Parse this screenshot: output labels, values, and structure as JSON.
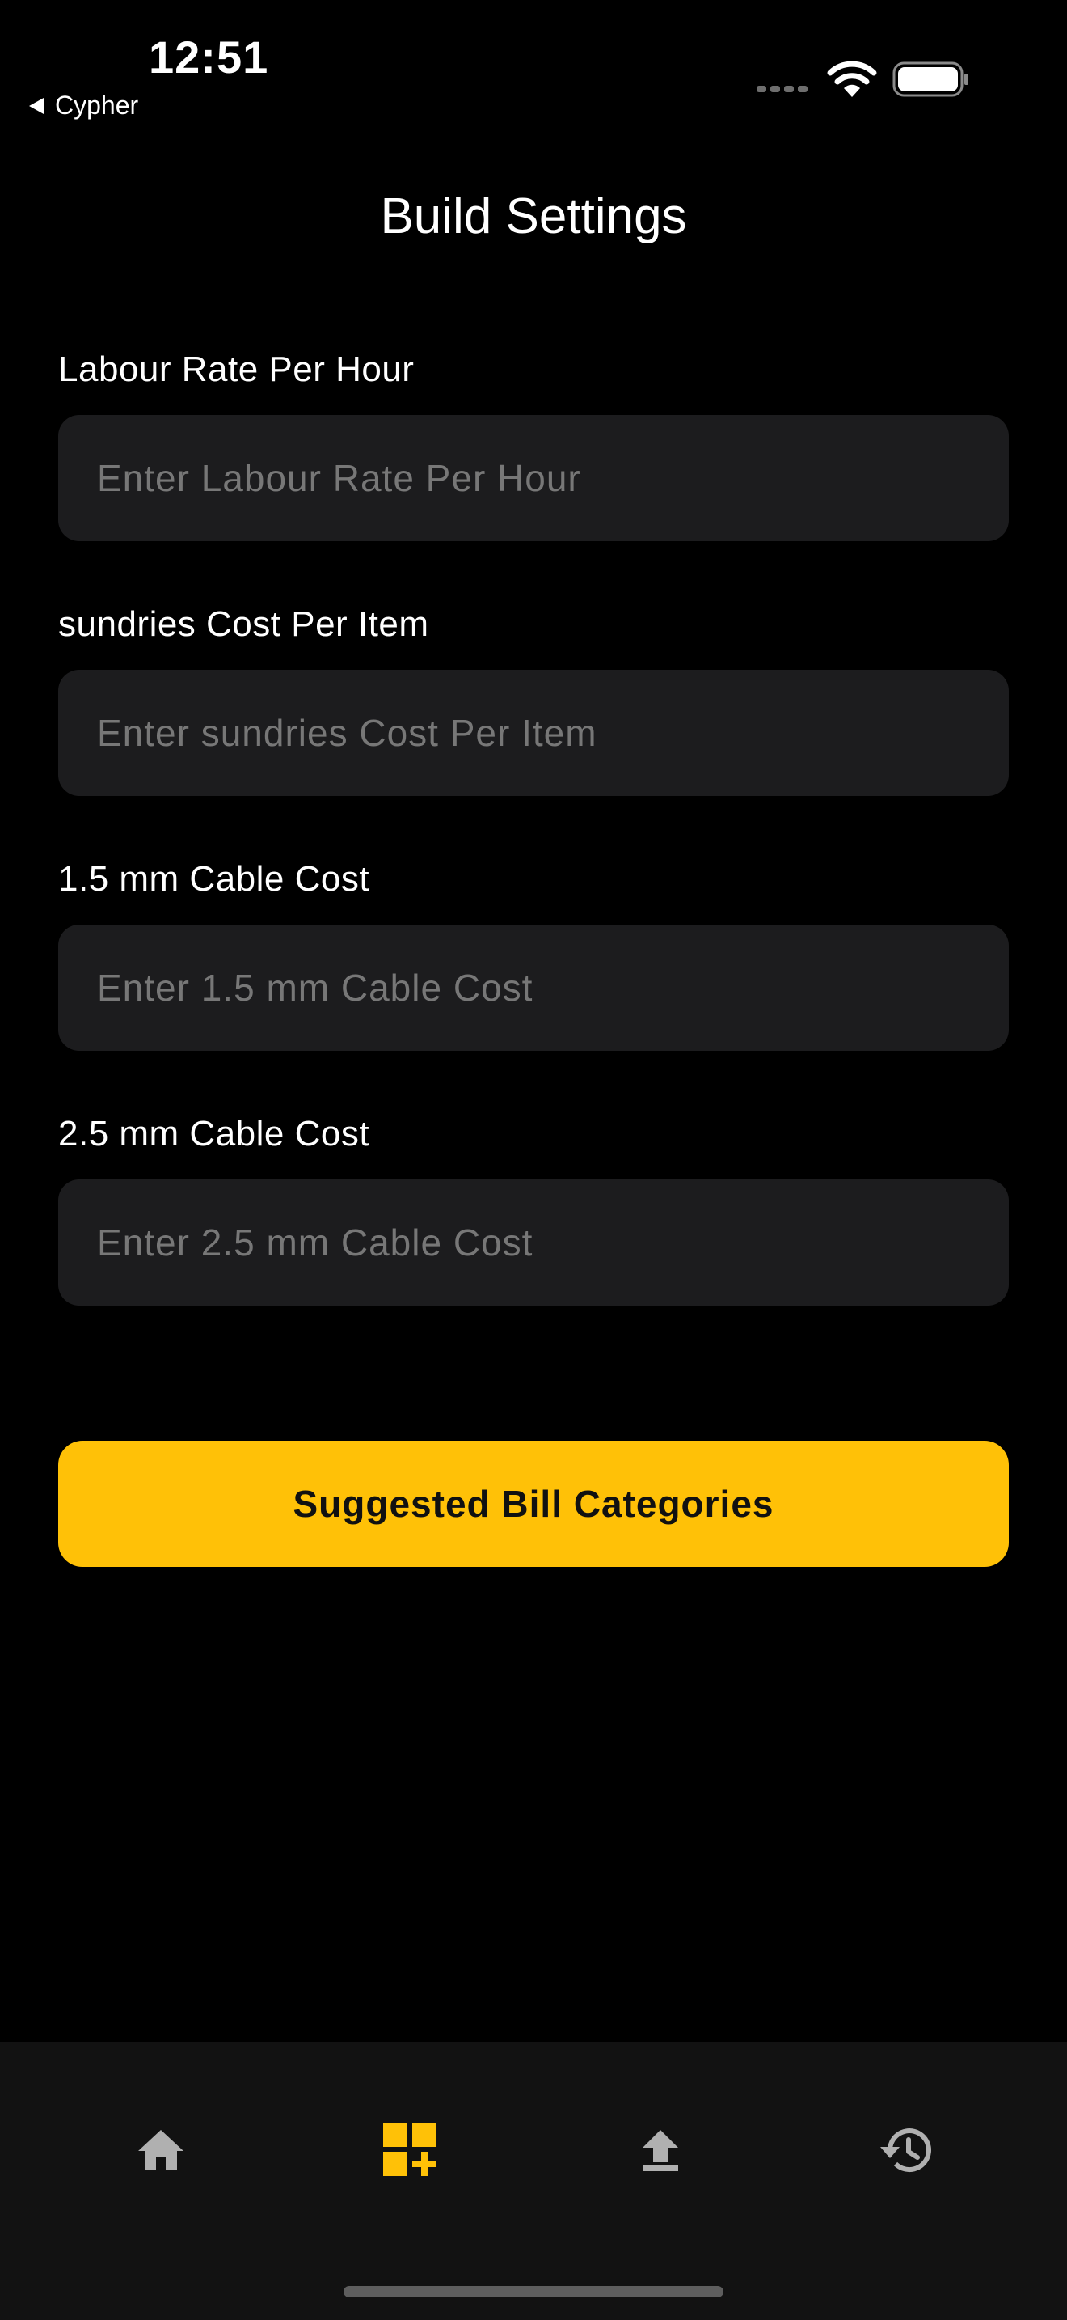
{
  "status_bar": {
    "time": "12:51",
    "back_app": "Cypher"
  },
  "header": {
    "title": "Build Settings"
  },
  "form": {
    "fields": [
      {
        "label": "Labour Rate Per Hour",
        "placeholder": "Enter Labour Rate Per Hour",
        "value": ""
      },
      {
        "label": "sundries Cost Per Item",
        "placeholder": "Enter sundries Cost Per Item",
        "value": ""
      },
      {
        "label": "1.5 mm Cable Cost",
        "placeholder": "Enter 1.5 mm Cable Cost",
        "value": ""
      },
      {
        "label": "2.5 mm Cable Cost",
        "placeholder": "Enter 2.5 mm Cable Cost",
        "value": ""
      }
    ],
    "primary_button_label": "Suggested Bill Categories"
  },
  "tab_bar": {
    "tabs": [
      {
        "icon": "home-icon",
        "active": false
      },
      {
        "icon": "dashboard-add-icon",
        "active": true
      },
      {
        "icon": "upload-icon",
        "active": false
      },
      {
        "icon": "history-icon",
        "active": false
      }
    ]
  },
  "colors": {
    "background": "#000000",
    "input_background": "#1c1c1e",
    "accent": "#ffc107",
    "tab_bar_background": "#121212",
    "inactive_icon": "#b0b0b0"
  }
}
